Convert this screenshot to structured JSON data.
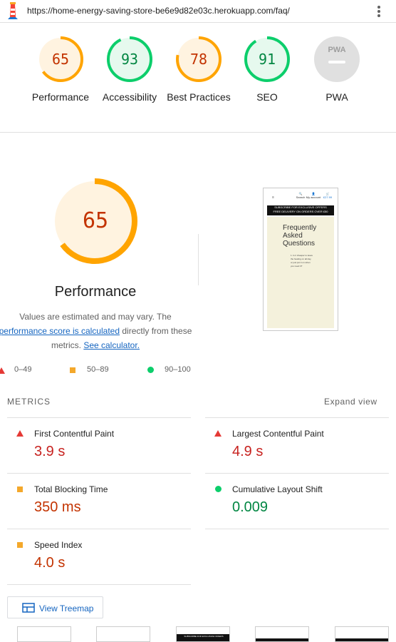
{
  "topbar": {
    "url": "https://home-energy-saving-store-be6e9d82e03c.herokuapp.com/faq/"
  },
  "summary": [
    {
      "label": "Performance",
      "score": "65",
      "score_value": 65,
      "status": "average"
    },
    {
      "label": "Accessibility",
      "score": "93",
      "score_value": 93,
      "status": "pass"
    },
    {
      "label": "Best Practices",
      "score": "78",
      "score_value": 78,
      "status": "average"
    },
    {
      "label": "SEO",
      "score": "91",
      "score_value": 91,
      "status": "pass"
    },
    {
      "label": "PWA",
      "score": "",
      "status": "na",
      "badge": "PWA"
    }
  ],
  "performance": {
    "score": "65",
    "score_value": 65,
    "title": "Performance",
    "desc_pre": "Values are estimated and may vary. The",
    "desc_link": "performance score is calculated",
    "desc_mid": "directly from these metrics.",
    "calc_link": "See calculator."
  },
  "screenshot": {
    "nav": [
      "Search",
      "My account",
      "£27.99"
    ],
    "banner_line1": "SUBSCRIBE FOR EXCLUSIVE OFFERS",
    "banner_line2": "FREE DELIVERY ON ORDERS OVER £50",
    "page_title": "Frequently Asked Questions",
    "question": "1. Is it cheaper to leave the heating on all day, or just put it on when you need it?"
  },
  "legend": [
    {
      "label": "0–49",
      "shape": "triangle",
      "color": "#e53935"
    },
    {
      "label": "50–89",
      "shape": "square",
      "color": "#f4a82b"
    },
    {
      "label": "90–100",
      "shape": "circle",
      "color": "#0cce6b"
    }
  ],
  "metrics_header": {
    "title": "METRICS",
    "expand": "Expand view"
  },
  "metrics": [
    {
      "name": "First Contentful Paint",
      "value": "3.9 s",
      "status": "fail"
    },
    {
      "name": "Largest Contentful Paint",
      "value": "4.9 s",
      "status": "fail"
    },
    {
      "name": "Total Blocking Time",
      "value": "350 ms",
      "status": "average"
    },
    {
      "name": "Cumulative Layout Shift",
      "value": "0.009",
      "status": "pass"
    },
    {
      "name": "Speed Index",
      "value": "4.0 s",
      "status": "average"
    }
  ],
  "treemap": {
    "label": "View Treemap"
  },
  "colors": {
    "fail": "#c7221f",
    "average": "#c33300",
    "pass": "#018642",
    "orange_arc": "#ffa400",
    "green_arc": "#0cce6b",
    "link": "#1565c0"
  }
}
